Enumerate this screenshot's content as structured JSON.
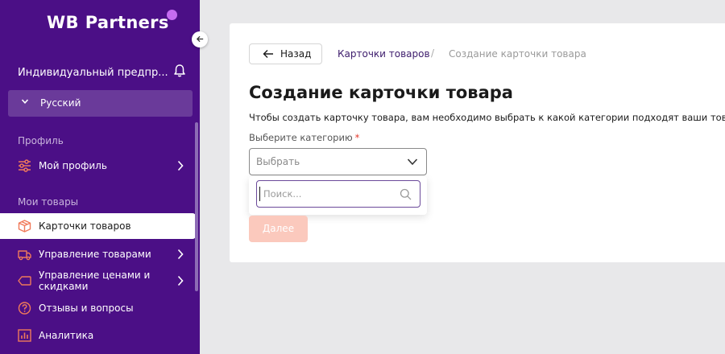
{
  "brand": {
    "logo_wb": "WB",
    "logo_partners": "Partners"
  },
  "sidebar": {
    "org_name": "Индивидуальный предпр...",
    "language": "Русский",
    "section_profile": "Профиль",
    "section_goods": "Мои товары",
    "items": [
      {
        "label": "Мой профиль",
        "icon": "sliders-icon"
      },
      {
        "label": "Карточки товаров",
        "icon": "box-icon",
        "active": true
      },
      {
        "label": "Управление товарами",
        "icon": "truck-icon"
      },
      {
        "label": "Управление ценами и скидками",
        "icon": "tag-icon"
      },
      {
        "label": "Отзывы и вопросы",
        "icon": "question-icon"
      },
      {
        "label": "Аналитика",
        "icon": "chart-icon"
      }
    ]
  },
  "breadcrumb": {
    "back": "Назад",
    "link": "Карточки товаров",
    "separator": "/",
    "current": "Создание карточки товара"
  },
  "main": {
    "title": "Создание карточки товара",
    "description": "Чтобы создать карточку товара, вам необходимо выбрать к какой категории подходят ваши товары.",
    "category_label": "Выберите категорию",
    "required_mark": "*",
    "select_placeholder": "Выбрать",
    "search_placeholder": "Поиск...",
    "next_button": "Далее"
  },
  "colors": {
    "sidebar_bg": "#4b0f86",
    "accent_icon": "#f07a5a",
    "next_button_disabled": "#fbc9bd"
  }
}
